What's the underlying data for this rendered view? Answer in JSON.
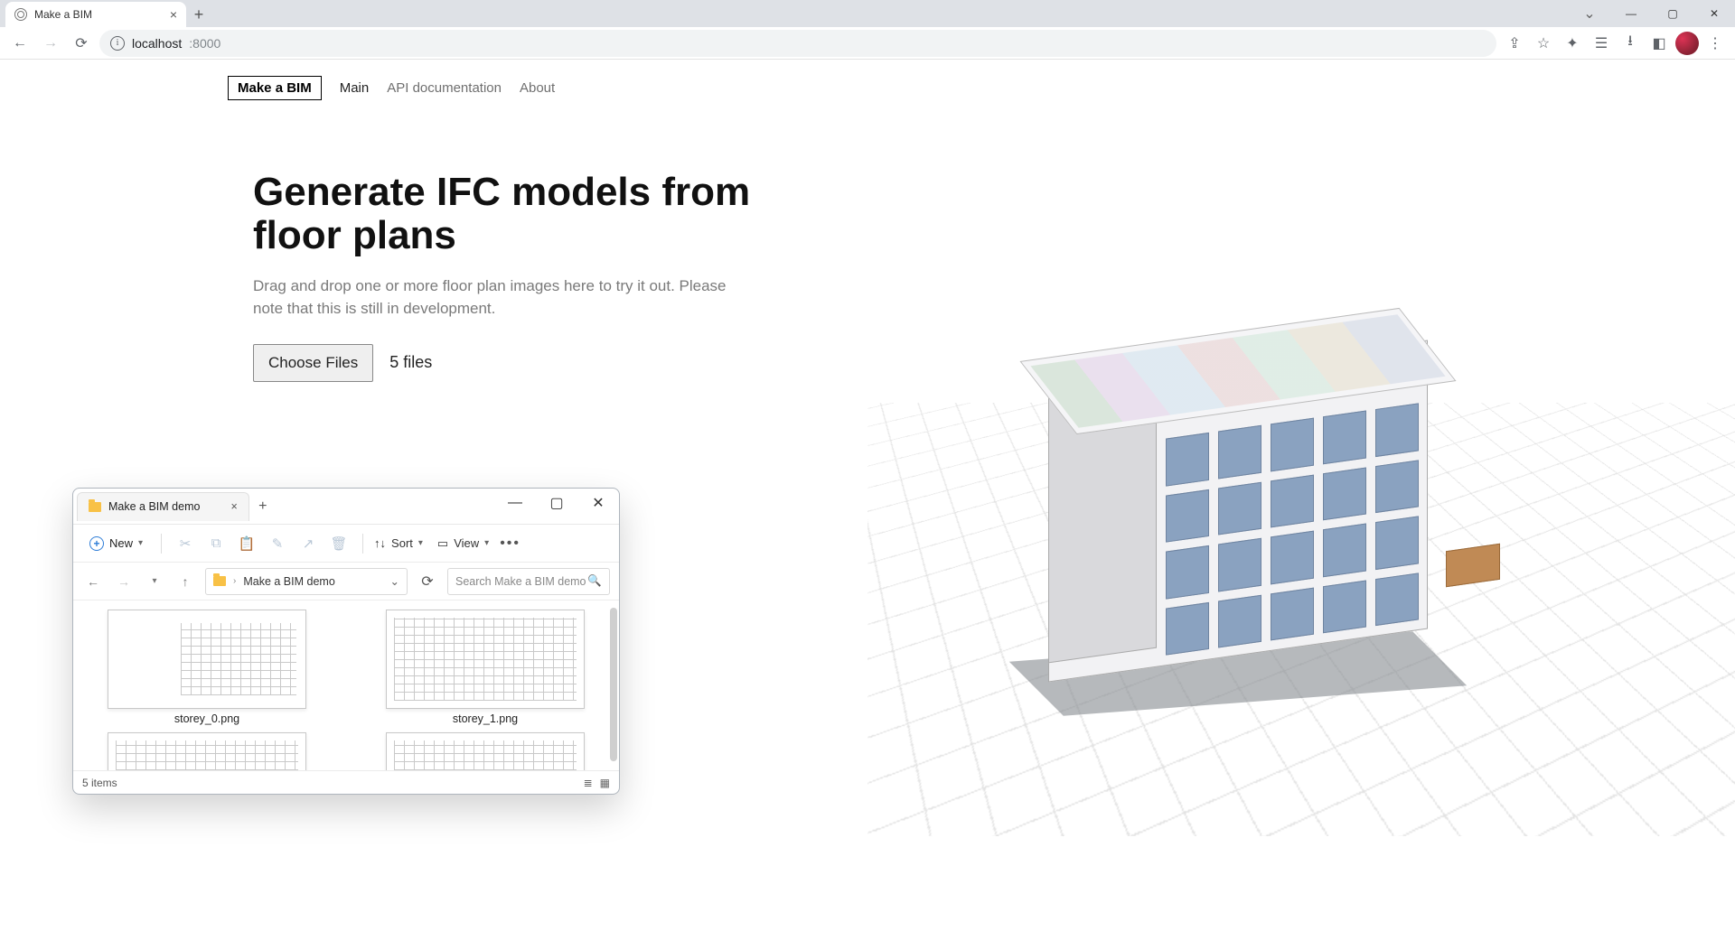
{
  "browser": {
    "tab_title": "Make a BIM",
    "url_host": "localhost",
    "url_port": ":8000"
  },
  "nav": {
    "logo": "Make a BIM",
    "links": [
      "Main",
      "API documentation",
      "About"
    ],
    "active_index": 0
  },
  "hero": {
    "title": "Generate IFC models from floor plans",
    "subtitle": "Drag and drop one or more floor plan images here to try it out. Please note that this is still in development.",
    "choose_label": "Choose Files",
    "file_count_label": "5 files"
  },
  "explorer": {
    "tab_title": "Make a BIM demo",
    "new_label": "New",
    "sort_label": "Sort",
    "view_label": "View",
    "breadcrumb": "Make a BIM demo",
    "search_placeholder": "Search Make a BIM demo",
    "items": [
      {
        "label": "storey_0.png"
      },
      {
        "label": "storey_1.png"
      },
      {
        "label": ""
      },
      {
        "label": ""
      }
    ],
    "status": "5 items"
  }
}
